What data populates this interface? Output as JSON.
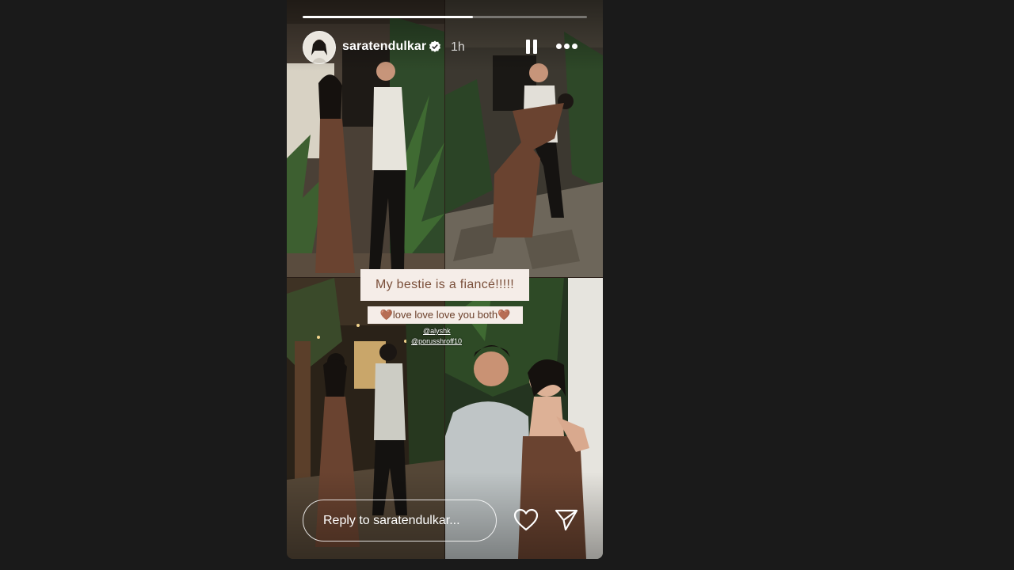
{
  "story": {
    "username": "saratendulkar",
    "verified": true,
    "time_ago": "1h",
    "progress": 0.6,
    "controls": {
      "pause_icon": "pause-icon",
      "more_icon": "more-icon"
    }
  },
  "stickers": {
    "caption_main": "My bestie is a fiancé!!!!!",
    "caption_love": "🤎love love love you both🤎",
    "mentions": [
      "@alyshk",
      "@porusshroff10"
    ]
  },
  "footer": {
    "reply_placeholder": "Reply to saratendulkar...",
    "like_icon": "heart-icon",
    "share_icon": "send-icon"
  },
  "colors": {
    "page_bg": "#1a1a1a",
    "sticker_bg": "#f5ede8",
    "sticker_text": "#7a4f3a",
    "dress": "#6a4330"
  }
}
